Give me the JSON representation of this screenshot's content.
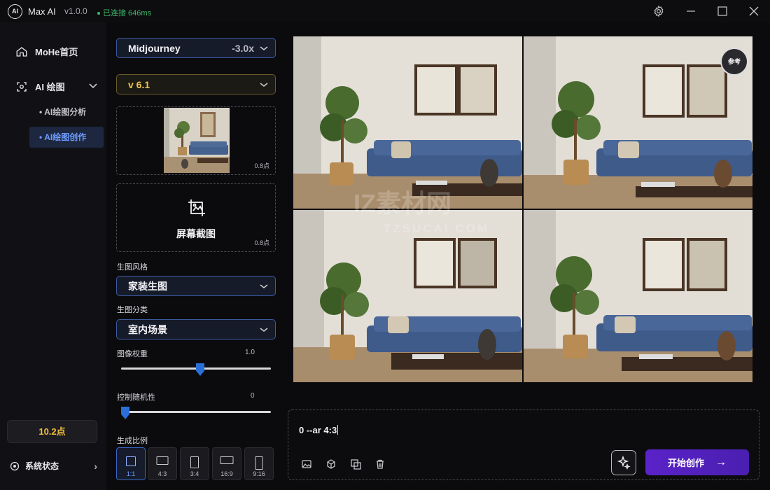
{
  "app": {
    "logo_text": "AI",
    "name": "Max AI",
    "version": "v1.0.0",
    "connection": "已连接 646ms"
  },
  "sidebar": {
    "home_label": "MoHe首页",
    "ai_draw_label": "AI 绘图",
    "sub_items": [
      {
        "label": "AI绘图分析",
        "active": false
      },
      {
        "label": "AI绘图创作",
        "active": true
      }
    ],
    "points": "10.2点",
    "system_status": "系统状态"
  },
  "controls": {
    "model": "Midjourney",
    "multiplier": "-3.0x",
    "version": "v 6.1",
    "reference_cost": "0.8点",
    "screenshot_label": "屏幕截图",
    "screenshot_cost": "0.8点",
    "style_label": "生图风格",
    "style_value": "家装生图",
    "category_label": "生图分类",
    "category_value": "室内场景",
    "weight_label": "图像权重",
    "weight_value": "1.0",
    "weight_level": 0.5,
    "random_label": "控制随机性",
    "random_value": "0",
    "random_level": 0.0,
    "ratio_label": "生成比例",
    "ratios": [
      {
        "label": "1:1",
        "active": true
      },
      {
        "label": "4:3",
        "active": false
      },
      {
        "label": "3:4",
        "active": false
      },
      {
        "label": "16:9",
        "active": false
      },
      {
        "label": "9:16",
        "active": false
      }
    ]
  },
  "result": {
    "ref_badge": "参考",
    "watermark_cn": "IZ素材网",
    "watermark_en": "TZSUCAI.COM"
  },
  "prompt": {
    "text": "0 --ar 4:3",
    "start_label": "开始创作"
  },
  "colors": {
    "accent_blue": "#3a66c8",
    "gold": "#f0c44c",
    "start_button": "#5a22c8",
    "connected_green": "#3cb868"
  }
}
